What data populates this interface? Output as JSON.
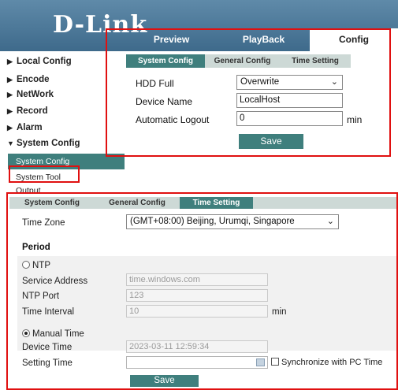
{
  "header": {
    "logo": "D-Link",
    "tabs": [
      {
        "label": "Preview"
      },
      {
        "label": "PlayBack"
      },
      {
        "label": "Config"
      }
    ]
  },
  "menu": {
    "items": [
      {
        "arrow": "▶",
        "label": "Local Config"
      },
      {
        "arrow": "▶",
        "label": "Encode"
      },
      {
        "arrow": "▶",
        "label": "NetWork"
      },
      {
        "arrow": "▶",
        "label": "Record"
      },
      {
        "arrow": "▶",
        "label": "Alarm"
      },
      {
        "arrow": "▼",
        "label": "System Config"
      }
    ],
    "sub_items": [
      {
        "label": "System Config"
      },
      {
        "label": "System Tool"
      },
      {
        "label": "Output"
      }
    ]
  },
  "top_panel": {
    "tabs": [
      {
        "label": "System Config"
      },
      {
        "label": "General Config"
      },
      {
        "label": "Time Setting"
      }
    ],
    "hdd_full": {
      "label": "HDD Full",
      "value": "Overwrite"
    },
    "device_name": {
      "label": "Device Name",
      "value": "LocalHost"
    },
    "auto_logout": {
      "label": "Automatic Logout",
      "value": "0",
      "unit": "min"
    },
    "save_label": "Save"
  },
  "bottom_panel": {
    "tabs": [
      {
        "label": "System Config"
      },
      {
        "label": "General Config"
      },
      {
        "label": "Time Setting"
      }
    ],
    "time_zone": {
      "label": "Time Zone",
      "value": "(GMT+08:00) Beijing, Urumqi, Singapore"
    },
    "period_label": "Period",
    "ntp": {
      "label": "NTP",
      "selected": false,
      "service_address": {
        "label": "Service Address",
        "value": "time.windows.com"
      },
      "ntp_port": {
        "label": "NTP Port",
        "value": "123"
      },
      "time_interval": {
        "label": "Time Interval",
        "value": "10",
        "unit": "min"
      }
    },
    "manual": {
      "label": "Manual Time",
      "selected": true,
      "device_time": {
        "label": "Device Time",
        "value": "2023-03-11 12:59:34"
      },
      "setting_time": {
        "label": "Setting Time",
        "value": ""
      },
      "sync_label": "Synchronize with PC Time"
    },
    "save_label": "Save"
  },
  "colors": {
    "accent": "#3f7f7d",
    "header": "#4a7595",
    "highlight": "#e01010"
  }
}
